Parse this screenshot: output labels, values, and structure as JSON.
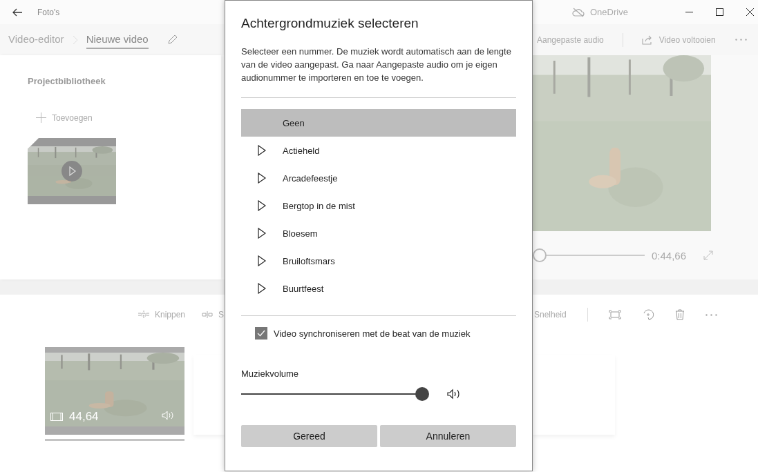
{
  "window": {
    "title": "Foto's",
    "cloud_label": "OneDrive"
  },
  "breadcrumb": [
    {
      "label": "Video-editor",
      "selected": false
    },
    {
      "label": "Nieuwe video",
      "selected": true
    }
  ],
  "header_actions": {
    "custom_audio": "Aangepaste audio",
    "finish": "Video voltooien"
  },
  "library": {
    "title": "Projectbibliotheek",
    "add_label": "Toevoegen"
  },
  "preview": {
    "time": "0:44,66",
    "level": 0
  },
  "edit_toolbar": {
    "items": [
      {
        "kind": "trim",
        "label": "Knippen"
      },
      {
        "kind": "split",
        "label": "S"
      }
    ],
    "speed_label": "Snelheid"
  },
  "clip": {
    "duration": "44,64"
  },
  "dialog": {
    "title": "Achtergrondmuziek selecteren",
    "description": "Selecteer een nummer. De muziek wordt automatisch aan de lengte van de video aangepast. Ga naar Aangepaste audio om je eigen audionummer te importeren en toe te voegen.",
    "tracks": [
      {
        "kind": "none",
        "label": "Geen",
        "selected": true
      },
      {
        "kind": "track",
        "label": "Actieheld",
        "selected": false
      },
      {
        "kind": "track",
        "label": "Arcadefeestje",
        "selected": false
      },
      {
        "kind": "track",
        "label": "Bergtop in de mist",
        "selected": false
      },
      {
        "kind": "track",
        "label": "Bloesem",
        "selected": false
      },
      {
        "kind": "track",
        "label": "Bruiloftsmars",
        "selected": false
      },
      {
        "kind": "track",
        "label": "Buurtfeest",
        "selected": false
      }
    ],
    "sync": {
      "label": "Video synchroniseren met de beat van de muziek",
      "checked": true
    },
    "volume": {
      "label": "Muziekvolume",
      "level": 0.97
    },
    "buttons": [
      "Gereed",
      "Annuleren"
    ]
  }
}
